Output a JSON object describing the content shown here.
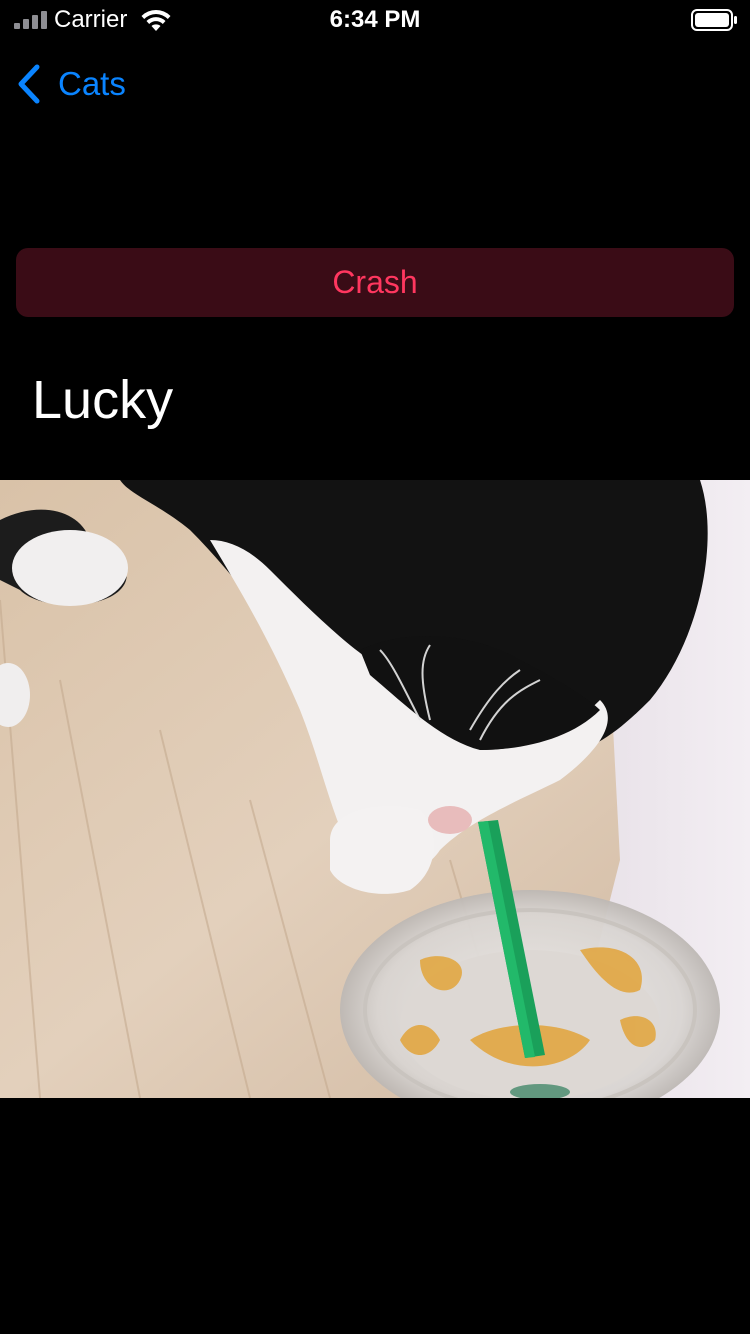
{
  "status_bar": {
    "carrier": "Carrier",
    "time": "6:34 PM",
    "icons": [
      "cellular-signal-icon",
      "wifi-icon",
      "battery-icon"
    ]
  },
  "nav": {
    "back_label": "Cats",
    "back_icon": "chevron-left-icon",
    "accent_color": "#0a84ff"
  },
  "crash_button": {
    "label": "Crash",
    "text_color": "#ff375f",
    "background_color": "#3a0c16"
  },
  "cat": {
    "name": "Lucky"
  }
}
